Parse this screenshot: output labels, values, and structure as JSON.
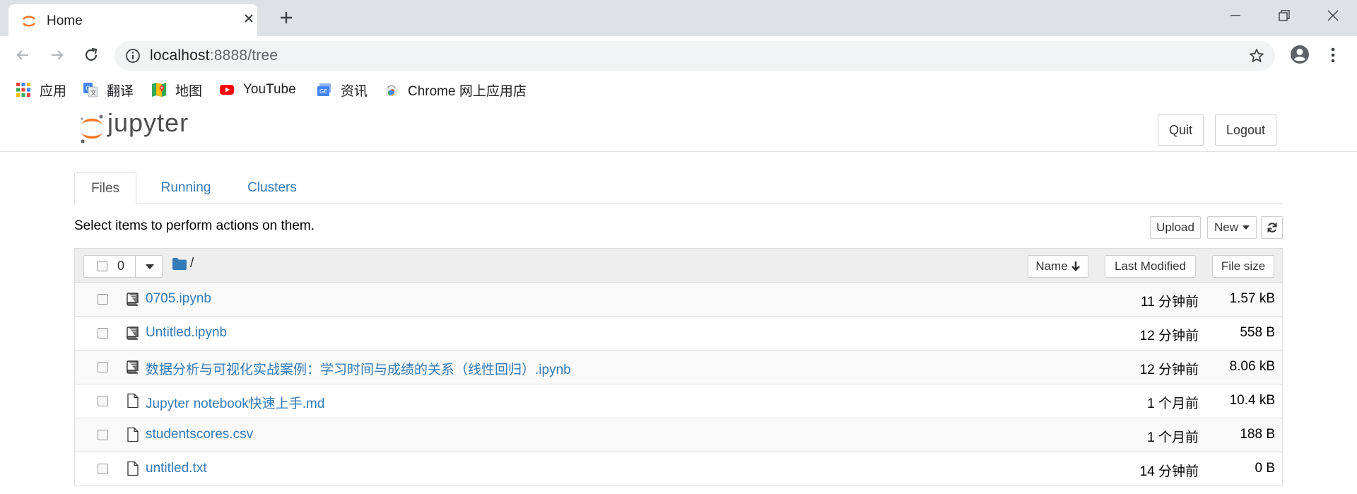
{
  "browser": {
    "tab_title": "Home",
    "url_host": "localhost",
    "url_rest": ":8888/tree"
  },
  "bookmarks": [
    {
      "label": "应用",
      "icon": "apps-grid-icon"
    },
    {
      "label": "翻译",
      "icon": "translate-icon"
    },
    {
      "label": "地图",
      "icon": "maps-icon"
    },
    {
      "label": "YouTube",
      "icon": "youtube-icon"
    },
    {
      "label": "资讯",
      "icon": "news-icon"
    },
    {
      "label": "Chrome 网上应用店",
      "icon": "chrome-web-store-icon"
    }
  ],
  "jupyter": {
    "logo_text": "jupyter",
    "quit_label": "Quit",
    "logout_label": "Logout",
    "tabs": [
      "Files",
      "Running",
      "Clusters"
    ],
    "active_tab": "Files",
    "instructions": "Select items to perform actions on them.",
    "upload_label": "Upload",
    "new_label": "New",
    "selected_count": "0",
    "breadcrumb": "/",
    "sort_name_label": "Name",
    "last_modified_label": "Last Modified",
    "file_size_label": "File size",
    "accent": "#337ab7"
  },
  "files": [
    {
      "name": "0705.ipynb",
      "type": "notebook",
      "modified": "11 分钟前",
      "size": "1.57 kB"
    },
    {
      "name": "Untitled.ipynb",
      "type": "notebook",
      "modified": "12 分钟前",
      "size": "558 B"
    },
    {
      "name": "数据分析与可视化实战案例：学习时间与成绩的关系（线性回归）.ipynb",
      "type": "notebook",
      "modified": "12 分钟前",
      "size": "8.06 kB"
    },
    {
      "name": "Jupyter notebook快速上手.md",
      "type": "file",
      "modified": "1 个月前",
      "size": "10.4 kB"
    },
    {
      "name": "studentscores.csv",
      "type": "file",
      "modified": "1 个月前",
      "size": "188 B"
    },
    {
      "name": "untitled.txt",
      "type": "file",
      "modified": "14 分钟前",
      "size": "0 B"
    }
  ]
}
